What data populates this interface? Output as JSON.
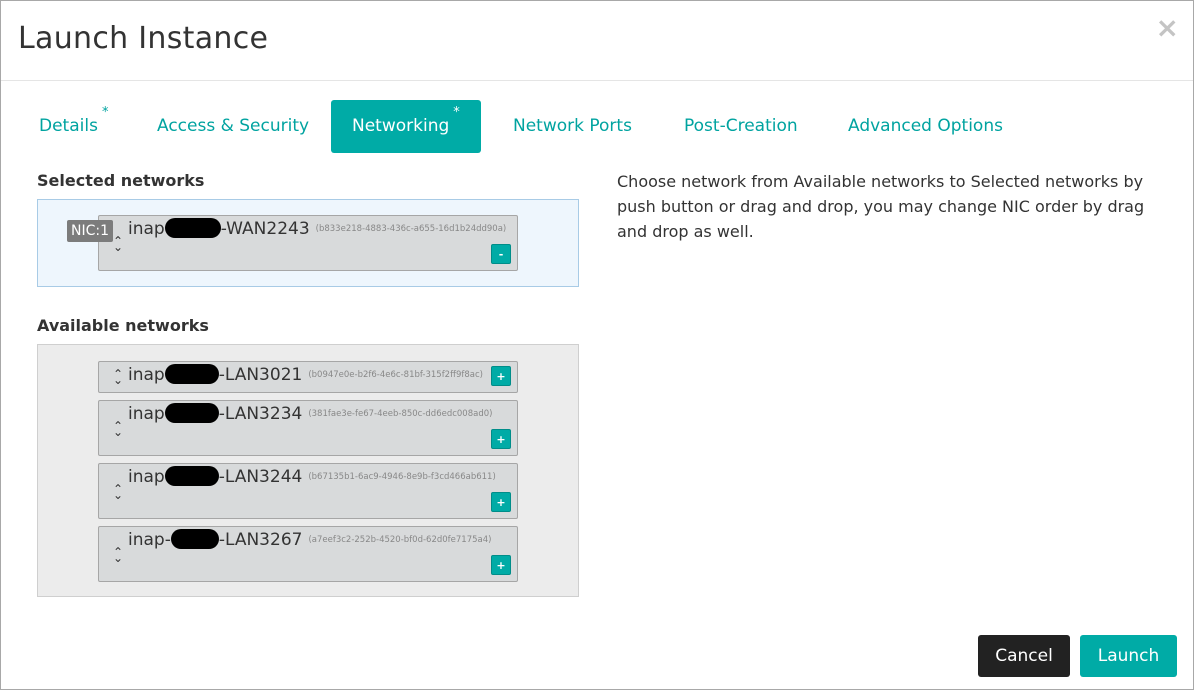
{
  "dialog": {
    "title": "Launch Instance",
    "close": "×"
  },
  "tabs": [
    {
      "label": "Details",
      "required": "*"
    },
    {
      "label": "Access & Security"
    },
    {
      "label": "Networking",
      "required": "*"
    },
    {
      "label": "Network Ports"
    },
    {
      "label": "Post-Creation"
    },
    {
      "label": "Advanced Options"
    }
  ],
  "selected": {
    "title": "Selected networks",
    "nic_badge": "NIC:1",
    "items": [
      {
        "prefix": "inap",
        "suffix": "-WAN2243",
        "id": "(b833e218-4883-436c-a655-16d1b24dd90a)",
        "action": "-"
      }
    ]
  },
  "available": {
    "title": "Available networks",
    "items": [
      {
        "prefix": "inap",
        "suffix": "-LAN3021",
        "id": "(b0947e0e-b2f6-4e6c-81bf-315f2ff9f8ac)",
        "action": "+"
      },
      {
        "prefix": "inap",
        "suffix": "-LAN3234",
        "id": "(381fae3e-fe67-4eeb-850c-dd6edc008ad0)",
        "action": "+"
      },
      {
        "prefix": "inap",
        "suffix": "-LAN3244",
        "id": "(b67135b1-6ac9-4946-8e9b-f3cd466ab611)",
        "action": "+"
      },
      {
        "prefix": "inap-",
        "suffix": "-LAN3267",
        "id": "(a7eef3c2-252b-4520-bf0d-62d0fe7175a4)",
        "action": "+"
      }
    ]
  },
  "help_text": "Choose network from Available networks to Selected networks by push button or drag and drop, you may change NIC order by drag and drop as well.",
  "buttons": {
    "cancel": "Cancel",
    "launch": "Launch"
  },
  "icons": {
    "sort": "sort-icon",
    "close": "close-icon"
  },
  "colors": {
    "accent": "#00aba6",
    "dark_button": "#222222",
    "selected_area": "#eef6fd",
    "available_area": "#ececec"
  }
}
